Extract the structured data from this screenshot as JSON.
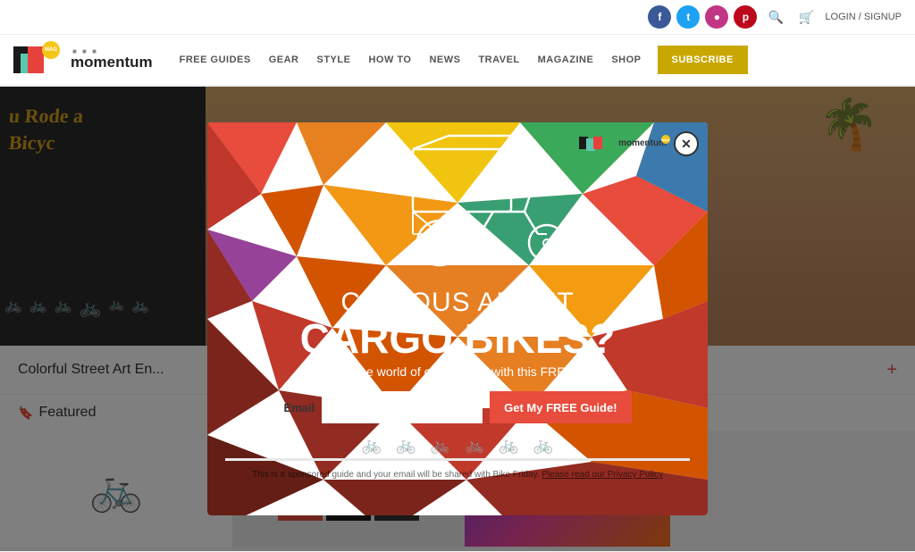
{
  "site": {
    "name": "momentum",
    "mag_badge": "MAG"
  },
  "header": {
    "social": [
      {
        "name": "facebook",
        "label": "f",
        "class": "si-fb"
      },
      {
        "name": "twitter",
        "label": "t",
        "class": "si-tw"
      },
      {
        "name": "instagram",
        "label": "i",
        "class": "si-ig"
      },
      {
        "name": "pinterest",
        "label": "p",
        "class": "si-pi"
      }
    ],
    "login_label": "LOGIN / SIGNUP",
    "nav_items": [
      "FREE GUIDES",
      "GEAR",
      "STYLE",
      "HOW TO",
      "NEWS",
      "TRAVEL",
      "MAGAZINE",
      "SHOP"
    ],
    "subscribe_label": "SUBSCRIBE"
  },
  "article": {
    "title": "Colorful Street Art En...",
    "plus": "+"
  },
  "featured": {
    "label": "Featured"
  },
  "modal": {
    "close_label": "✕",
    "logo_label": "momentum",
    "headline_sub": "CURIOUS ABOUT",
    "headline_main": "CARGO BIKES?",
    "subtext": "Discover the world of cargo bikes with this FREE guide.",
    "email_label": "Email",
    "email_placeholder": "",
    "submit_label": "Get My FREE Guide!",
    "footer_text": "This is a sponsored guide and your email will be shared with Bike Friday.",
    "privacy_label": "Please read our Privacy Policy"
  }
}
